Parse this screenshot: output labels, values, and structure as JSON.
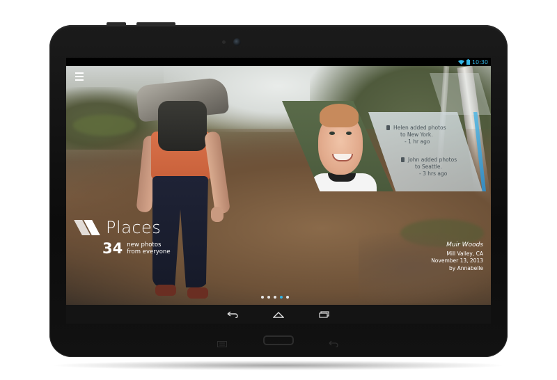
{
  "status_bar": {
    "time": "10:30",
    "icons": [
      "wifi-icon",
      "battery-icon"
    ],
    "accent_color": "#33b5e5"
  },
  "app": {
    "menu_icon": "hamburger-menu-icon",
    "section_title": "Places",
    "new_photos_count": "34",
    "new_photos_label_line1": "new photos",
    "new_photos_label_line2": "from everyone"
  },
  "feed": {
    "items": [
      {
        "line1": "Helen added photos",
        "line2": "to New York.",
        "time": "- 1 hr ago"
      },
      {
        "line1": "John added photos",
        "line2": "to Seattle.",
        "time": "- 3 hrs ago"
      }
    ]
  },
  "location": {
    "title": "Muir Woods",
    "place": "Mill Valley, CA",
    "date": "November 13, 2013",
    "author": "by Annabelle"
  },
  "pager": {
    "count": 5,
    "active_index": 3
  },
  "nav_bar": {
    "buttons": [
      "back-icon",
      "home-icon",
      "recent-apps-icon"
    ]
  }
}
